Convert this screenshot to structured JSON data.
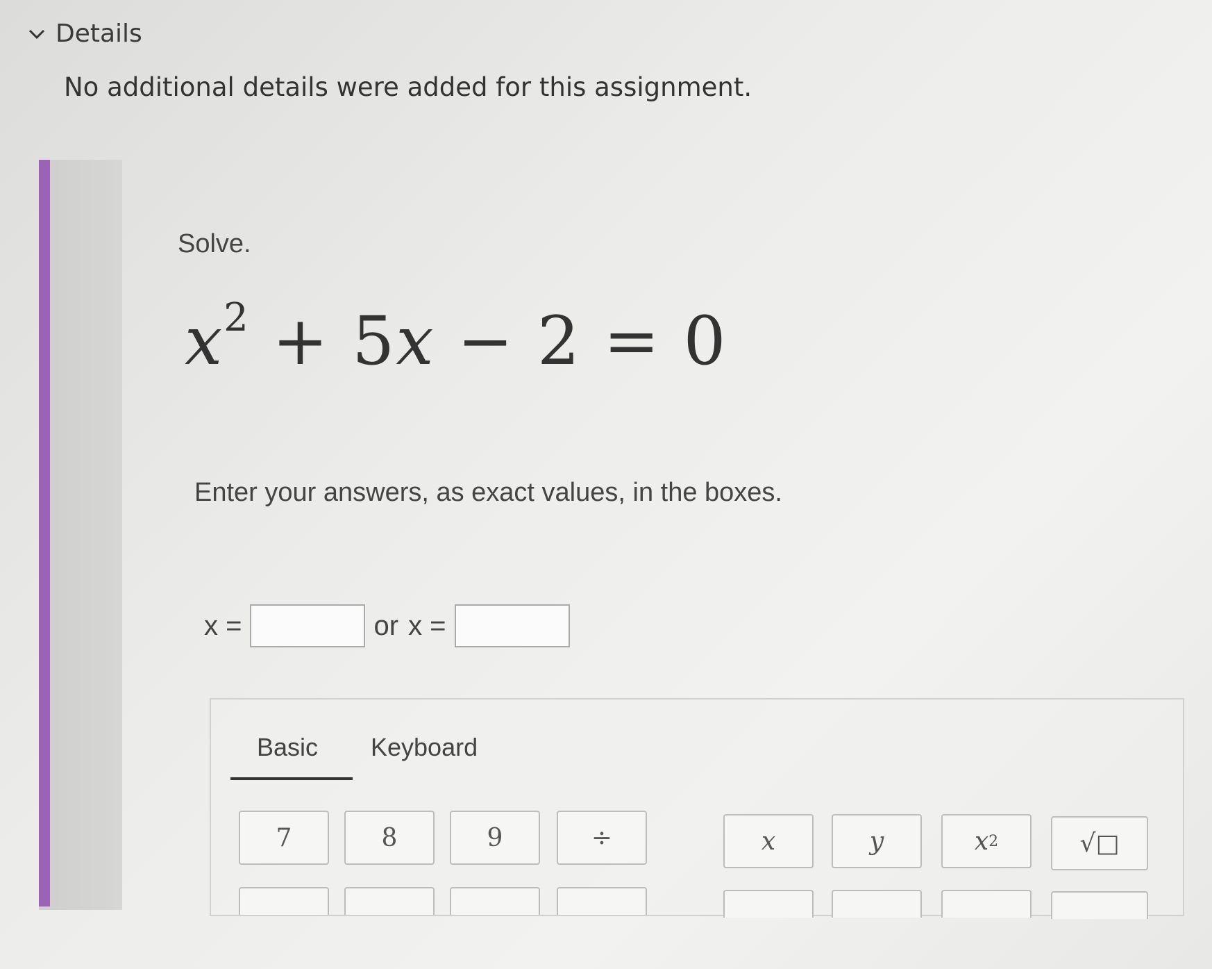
{
  "details": {
    "title": "Details",
    "text": "No additional details were added for this assignment."
  },
  "question": {
    "prompt": "Solve.",
    "equation": {
      "var": "x",
      "exponent": "2",
      "rest": " + 5",
      "var2": "x",
      "tail": " − 2 = 0"
    },
    "instructions": "Enter your answers, as exact values, in the boxes.",
    "answer": {
      "label1": "x =",
      "or_label": "or",
      "label2": "x ="
    }
  },
  "keypad": {
    "tabs": [
      "Basic",
      "Keyboard"
    ],
    "active_tab": "Basic",
    "keys": {
      "k7": "7",
      "k8": "8",
      "k9": "9",
      "div": "÷",
      "x": "x",
      "y": "y",
      "x2_base": "x",
      "x2_exp": "2",
      "sqrt": "√□"
    }
  },
  "colors": {
    "accent_bar": "#9b62b5"
  }
}
